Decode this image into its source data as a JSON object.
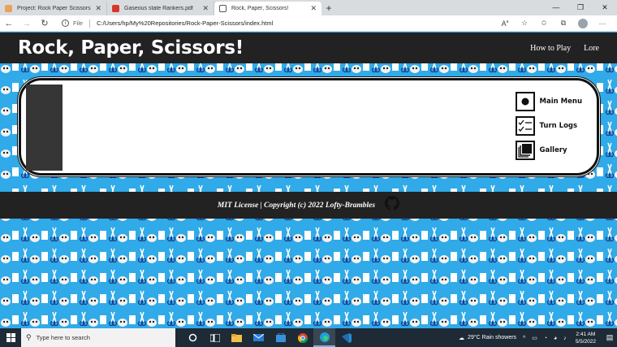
{
  "browser": {
    "tabs": [
      {
        "title": "Project: Rock Paper Scissors | The",
        "favicon_color": "#e9a15c",
        "active": false
      },
      {
        "title": "Gaseous state Rankers.pdf",
        "favicon_color": "#d9362b",
        "active": false
      },
      {
        "title": "Rock, Paper, Scissors!",
        "favicon_color": "#ffffff",
        "active": true
      }
    ],
    "address_scheme": "File",
    "address_url": "C:/Users/hp/My%20Repositories/Rock-Paper-Scissors/index.html"
  },
  "site": {
    "title": "Rock, Paper, Scissors!",
    "nav": [
      "How to Play",
      "Lore"
    ],
    "menu": [
      {
        "label": "Main Menu",
        "icon": "record-dot-icon"
      },
      {
        "label": "Turn Logs",
        "icon": "checklist-icon"
      },
      {
        "label": "Gallery",
        "icon": "gallery-icon"
      }
    ],
    "footer": "MIT License | Copyright (c) 2022 Lofty-Brambles"
  },
  "taskbar": {
    "search_placeholder": "Type here to search",
    "weather": "29°C  Rain showers",
    "time": "2:41 AM",
    "date": "5/5/2022"
  },
  "colors": {
    "page_bg": "#30aae8",
    "header_bg": "#222222",
    "panel_bg": "#ffffff",
    "taskbar_bg": "#1e2a36"
  }
}
